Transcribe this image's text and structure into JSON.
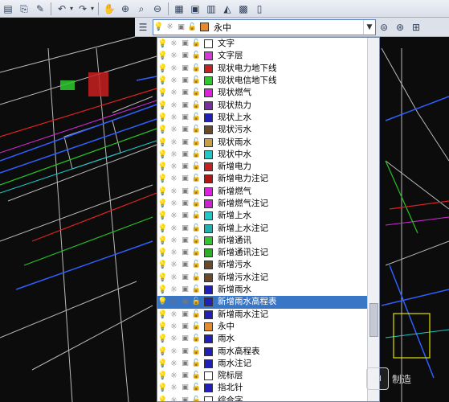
{
  "toolbar": {
    "icons": [
      "paste-layer-icon",
      "match-icon",
      "paint-icon",
      "undo-icon",
      "redo-icon",
      "pan-icon",
      "zoom-realtime-icon",
      "zoom-window-icon",
      "zoom-previous-icon",
      "properties-icon",
      "design-center-icon",
      "tool-palette-icon",
      "markup-icon",
      "calculator-icon",
      "sheet-icon"
    ]
  },
  "layer_control": {
    "current_layer": "永中",
    "current_color": "#e58a2e"
  },
  "layers": [
    {
      "name": "文字",
      "color": "#ffffff"
    },
    {
      "name": "文字层",
      "color": "#d838d8"
    },
    {
      "name": "现状电力地下线",
      "color": "#c82020"
    },
    {
      "name": "现状电信地下线",
      "color": "#2ec82e"
    },
    {
      "name": "现状燃气",
      "color": "#e020e0"
    },
    {
      "name": "现状热力",
      "color": "#7a2fa0"
    },
    {
      "name": "现状上水",
      "color": "#2020b8"
    },
    {
      "name": "现状污水",
      "color": "#6b4a2a"
    },
    {
      "name": "现状雨水",
      "color": "#c8a040"
    },
    {
      "name": "现状中水",
      "color": "#20c8c8"
    },
    {
      "name": "新增电力",
      "color": "#c82020"
    },
    {
      "name": "新增电力注记",
      "color": "#b01818"
    },
    {
      "name": "新增燃气",
      "color": "#e020e0"
    },
    {
      "name": "新增燃气注记",
      "color": "#d020d0"
    },
    {
      "name": "新增上水",
      "color": "#20c8c8"
    },
    {
      "name": "新增上水注记",
      "color": "#20b0b0"
    },
    {
      "name": "新增通讯",
      "color": "#2ec82e"
    },
    {
      "name": "新增通讯注记",
      "color": "#28b028"
    },
    {
      "name": "新增污水",
      "color": "#6b4a2a"
    },
    {
      "name": "新增污水注记",
      "color": "#6b4a2a"
    },
    {
      "name": "新增雨水",
      "color": "#2020b8"
    },
    {
      "name": "新增雨水高程表",
      "color": "#2020b8",
      "selected": true
    },
    {
      "name": "新增雨水注记",
      "color": "#2020b8"
    },
    {
      "name": "永中",
      "color": "#e58a2e"
    },
    {
      "name": "雨水",
      "color": "#2020b8"
    },
    {
      "name": "雨水高程表",
      "color": "#2020b8"
    },
    {
      "name": "雨水注记",
      "color": "#2020b8"
    },
    {
      "name": "院标层",
      "color": "#ffffff"
    },
    {
      "name": "指北针",
      "color": "#2020b8"
    },
    {
      "name": "综合字",
      "color": "#ffffff"
    }
  ],
  "watermark": {
    "logo_text": "AI",
    "text": "制造"
  }
}
